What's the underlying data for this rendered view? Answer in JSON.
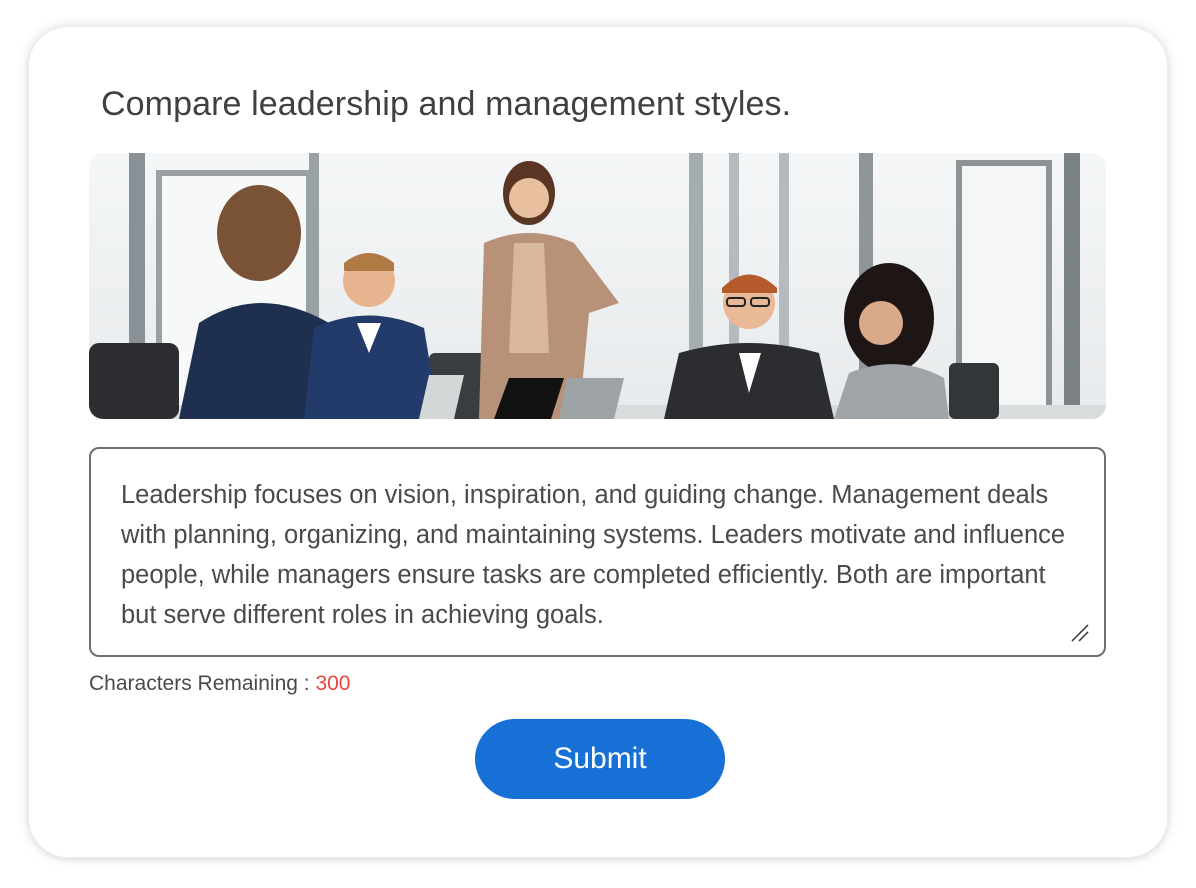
{
  "question": "Compare leadership and management styles.",
  "image": {
    "description_icon": "meeting-photo"
  },
  "answer": {
    "text": "Leadership focuses on vision, inspiration, and guiding change. Management deals with planning, organizing, and maintaining systems. Leaders motivate and influence people, while managers ensure tasks are completed efficiently. Both are important but serve different roles in achieving goals."
  },
  "counter": {
    "label": "Characters Remaining :",
    "value": "300"
  },
  "submit_label": "Submit",
  "colors": {
    "accent": "#1670d6",
    "counter_value": "#e8453c",
    "text": "#404040"
  }
}
